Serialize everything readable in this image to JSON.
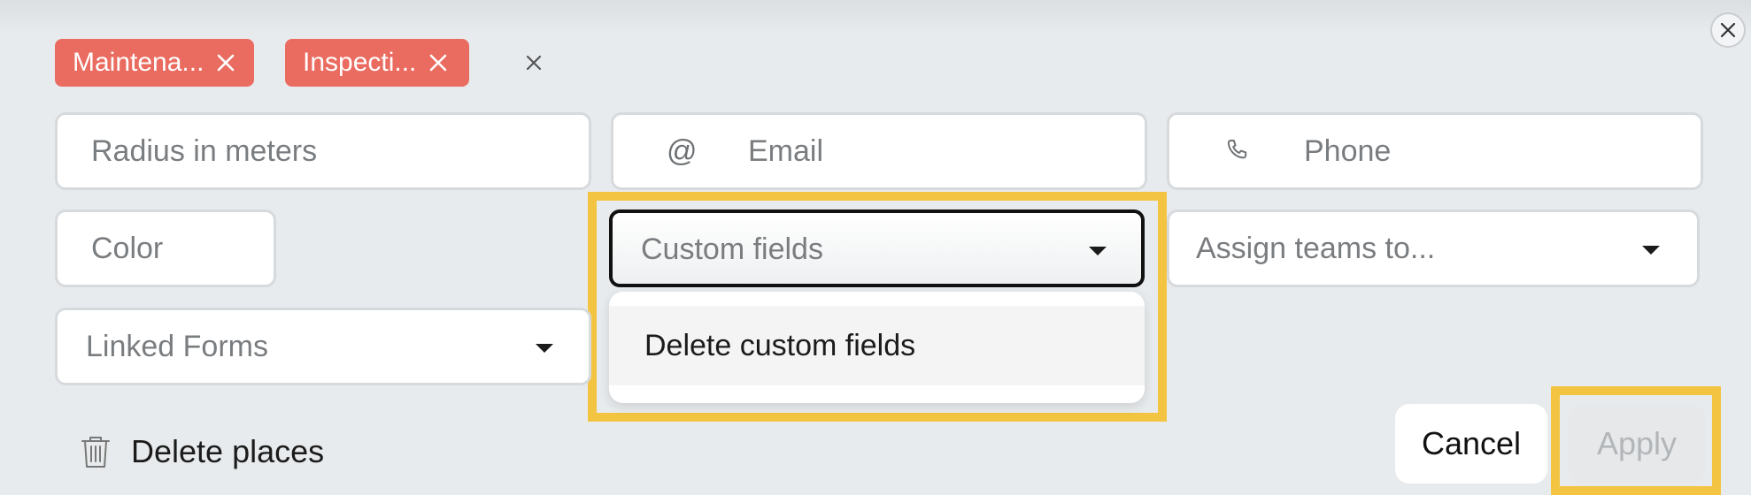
{
  "tags": [
    {
      "label": "Maintena..."
    },
    {
      "label": "Inspecti..."
    }
  ],
  "fields": {
    "radius_placeholder": "Radius in meters",
    "email_placeholder": "Email",
    "email_icon": "@",
    "phone_placeholder": "Phone",
    "color_placeholder": "Color",
    "custom_fields_placeholder": "Custom fields",
    "assign_teams_placeholder": "Assign teams to...",
    "linked_forms_placeholder": "Linked Forms"
  },
  "custom_fields_menu": {
    "items": [
      "Delete custom fields"
    ]
  },
  "actions": {
    "delete_places_label": "Delete places",
    "cancel_label": "Cancel",
    "apply_label": "Apply"
  },
  "colors": {
    "tag_bg": "#ea6b5f",
    "highlight": "#f3c442",
    "background": "#e8ebed"
  }
}
